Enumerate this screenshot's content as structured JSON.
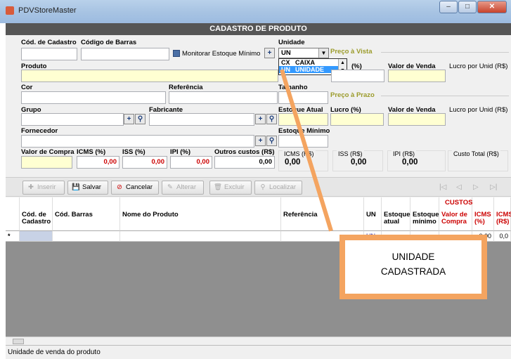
{
  "window": {
    "title": "PDVStoreMaster",
    "min": "–",
    "max": "□",
    "close": "✕"
  },
  "header": {
    "title": "CADASTRO DE PRODUTO"
  },
  "form": {
    "cod_cadastro": "Cód. de Cadastro",
    "cod_barras": "Código de Barras",
    "monitorar": "Monitorar Estoque Mínimo",
    "unidade": "Unidade",
    "unidade_value": "UN",
    "unidade_options": [
      {
        "code": "CX",
        "label": "CAIXA"
      },
      {
        "code": "UN",
        "label": "UNIDADE"
      }
    ],
    "preco_vista": "Preço à Vista",
    "preco_prazo": "Preço à Prazo",
    "produto": "Produto",
    "pct": "(%)",
    "valor_venda": "Valor de Venda",
    "lucro_unid": "Lucro por Unid (R$)",
    "cor": "Cor",
    "referencia": "Referência",
    "tamanho": "Tamanho",
    "grupo": "Grupo",
    "fabricante": "Fabricante",
    "estoque_atual": "Estoque Atual",
    "lucro_pct": "Lucro (%)",
    "fornecedor": "Fornecedor",
    "estoque_minimo": "Estoque Mínimo",
    "valor_compra": "Valor de Compra",
    "icms_pct": "ICMS (%)",
    "iss_pct": "ISS (%)",
    "ipi_pct": "IPI (%)",
    "outros": "Outros custos (R$)",
    "icms_value": "0,00",
    "iss_value": "0,00",
    "ipi_value": "0,00",
    "outros_value": "0,00",
    "icms_rs": "ICMS (R$)",
    "iss_rs": "ISS (R$)",
    "ipi_rs": "IPI (R$)",
    "custo_total": "Custo Total (R$)",
    "icms_rs_value": "0,00",
    "iss_rs_value": "0,00",
    "ipi_rs_value": "0,00"
  },
  "toolbar": {
    "inserir": "Inserir",
    "salvar": "Salvar",
    "cancelar": "Cancelar",
    "alterar": "Alterar",
    "excluir": "Excluir",
    "localizar": "Localizar"
  },
  "grid": {
    "custos": "CUSTOS",
    "cols": [
      "Cód. de Cadastro",
      "Cód. Barras",
      "Nome do Produto",
      "Referência",
      "UN",
      "Estoque atual",
      "Estoque mínimo",
      "Valor de Compra",
      "ICMS (%)",
      "ICMS (R$)"
    ],
    "row": {
      "marker": "*",
      "un": "UN",
      "icms_pct": "0,00",
      "icms_rs": "0,0"
    }
  },
  "status": "Unidade de venda do produto",
  "callout": {
    "line1": "UNIDADE",
    "line2": "CADASTRADA"
  }
}
